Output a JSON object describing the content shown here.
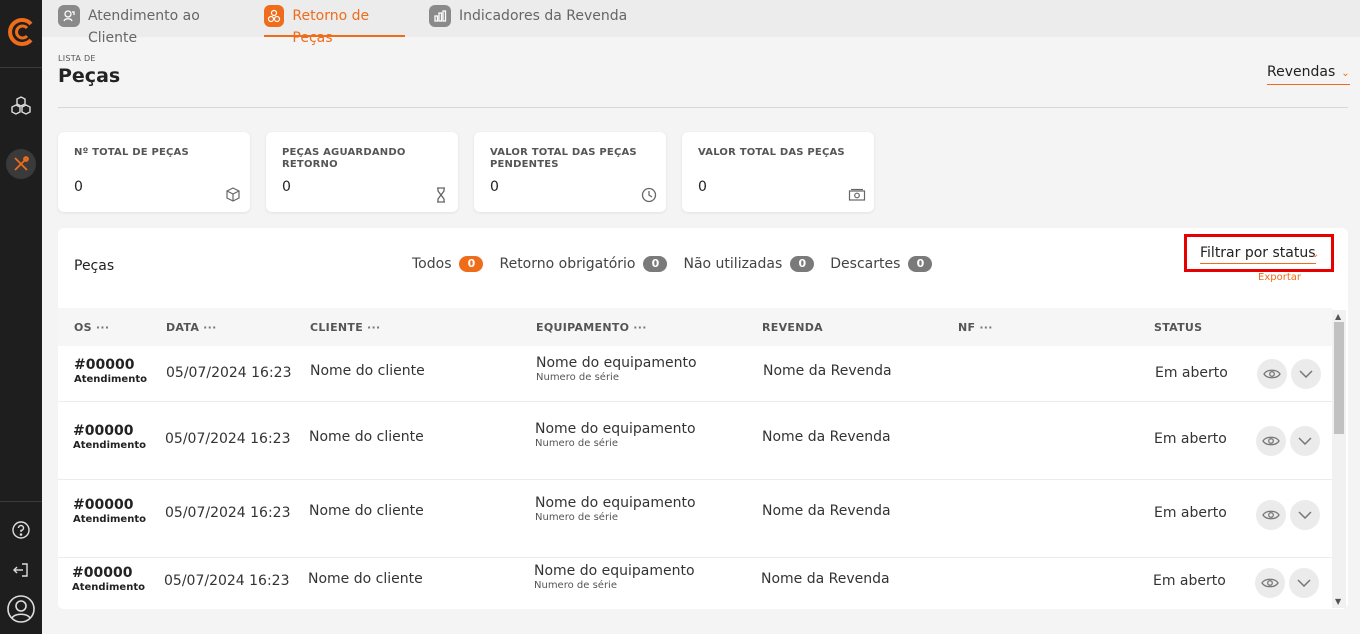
{
  "app": {
    "accent": "#ef6c1a",
    "sidebar_bg": "#1e1e1e",
    "highlight": "#e60000"
  },
  "sidebar": {
    "items": [
      {
        "icon": "logo-icon"
      },
      {
        "icon": "cubes-icon"
      },
      {
        "icon": "tools-icon",
        "active": true
      },
      {
        "icon": "help-icon"
      },
      {
        "icon": "logout-icon"
      },
      {
        "icon": "user-avatar-icon"
      }
    ]
  },
  "tabs": [
    {
      "label": "Atendimento ao Cliente",
      "icon": "customer-service-icon"
    },
    {
      "label": "Retorno de Peças",
      "icon": "parts-icon",
      "active": true
    },
    {
      "label": "Indicadores da Revenda",
      "icon": "bar-chart-icon"
    }
  ],
  "header": {
    "pre_title": "LISTA DE",
    "title": "Peças",
    "revendas_label": "Revendas",
    "chevron": "⌄"
  },
  "cards": [
    {
      "title": "Nº TOTAL DE PEÇAS",
      "value": "0",
      "icon": "box-icon"
    },
    {
      "title": "PEÇAS AGUARDANDO RETORNO",
      "value": "0",
      "icon": "hourglass-icon"
    },
    {
      "title": "VALOR TOTAL DAS PEÇAS PENDENTES",
      "value": "0",
      "icon": "clock-icon"
    },
    {
      "title": "VALOR TOTAL DAS PEÇAS",
      "value": "0",
      "icon": "money-icon"
    }
  ],
  "panel": {
    "title": "Peças",
    "filters": [
      {
        "label": "Todos",
        "count": "0",
        "active": true
      },
      {
        "label": "Retorno obrigatório",
        "count": "0"
      },
      {
        "label": "Não utilizadas",
        "count": "0"
      },
      {
        "label": "Descartes",
        "count": "0"
      }
    ],
    "filter_status_label": "Filtrar por status",
    "export_label": "Exportar"
  },
  "table": {
    "columns": [
      {
        "label": "OS",
        "dots": "···"
      },
      {
        "label": "DATA",
        "dots": "···"
      },
      {
        "label": "CLIENTE",
        "dots": "···"
      },
      {
        "label": "EQUIPAMENTO",
        "dots": "···"
      },
      {
        "label": "REVENDA",
        "dots": ""
      },
      {
        "label": "NF",
        "dots": "···"
      },
      {
        "label": "STATUS",
        "dots": ""
      }
    ],
    "rows": [
      {
        "os": "#00000",
        "os_type": "Atendimento",
        "date": "05/07/2024 16:23",
        "client": "Nome do cliente",
        "equipment": "Nome do equipamento",
        "serial": "Numero de série",
        "revenda": "Nome da Revenda",
        "nf": "",
        "status": "Em aberto"
      },
      {
        "os": "#00000",
        "os_type": "Atendimento",
        "date": "05/07/2024 16:23",
        "client": "Nome do cliente",
        "equipment": "Nome do equipamento",
        "serial": "Numero de série",
        "revenda": "Nome da Revenda",
        "nf": "",
        "status": "Em aberto"
      },
      {
        "os": "#00000",
        "os_type": "Atendimento",
        "date": "05/07/2024 16:23",
        "client": "Nome do cliente",
        "equipment": "Nome do equipamento",
        "serial": "Numero de série",
        "revenda": "Nome da Revenda",
        "nf": "",
        "status": "Em aberto"
      },
      {
        "os": "#00000",
        "os_type": "Atendimento",
        "date": "05/07/2024 16:23",
        "client": "Nome do cliente",
        "equipment": "Nome do equipamento",
        "serial": "Numero de série",
        "revenda": "Nome da Revenda",
        "nf": "",
        "status": "Em aberto"
      }
    ]
  }
}
